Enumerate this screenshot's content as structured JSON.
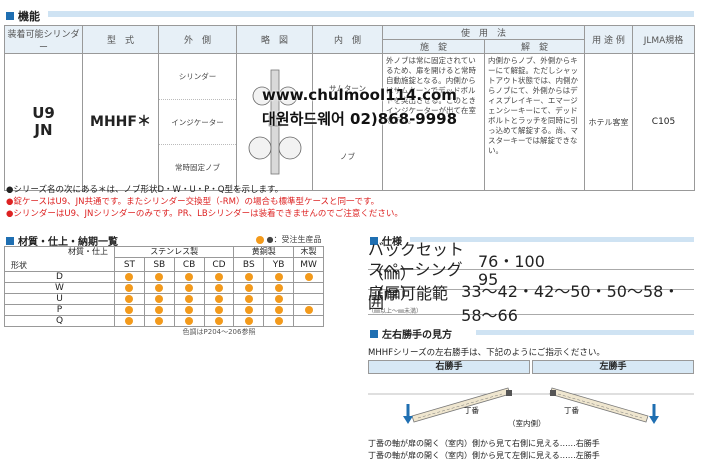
{
  "section_function": {
    "title": "機能"
  },
  "fn_table": {
    "headers": [
      "装着可能シリンダー",
      "型　式",
      "外　側",
      "略　図",
      "内　側",
      "使　用　法",
      "用 途 例",
      "JLMA規格"
    ],
    "usage_sub": [
      "施　錠",
      "解　錠"
    ],
    "cylinder": "U9\nJN",
    "model": "MHHF＊",
    "outside": [
      "シリンダー",
      "インジケーター",
      "常時固定ノブ"
    ],
    "inside": [
      "サムターン",
      "ノブ"
    ],
    "usage_lock": "外ノブは常に固定されているため、扉を開けると常時自動施錠となる。内側からはサムターンでデッドボルトを突出させる。このときインジケーターが出て在室を示す。",
    "usage_unlock": "内側からノブ、外側からキーにて解錠。ただしシャットアウト状態では、内側からノブにて、外側からはディスプレイキー、エマージェンシーキーにて、デッドボルトとラッチを同時に引っ込めて解錠する。尚、マスターキーでは解錠できない。",
    "example": "ホテル客室",
    "jlma": "C105"
  },
  "watermark": {
    "line1": "www.chulmool114.com",
    "line2": "대원하드웨어 02)868-9998"
  },
  "notes": [
    "●シリーズ名の次にある＊は、ノブ形状D・W・U・P・Q型を示します。",
    "●錠ケースはU9、JN共通です。またシリンダー交換型（-RM）の場合も標準型ケースと同一です。",
    "●シリンダーはU9、JNシリンダーのみです。PR、LBシリンダーは装着できませんのでご注意ください。"
  ],
  "materials": {
    "title": "材質・仕上・納期一覧",
    "legend": "●：受注生産品",
    "corner_top": "材質・仕上",
    "corner_bottom": "形状",
    "groups": [
      "ステンレス製",
      "黄銅製",
      "木製"
    ],
    "codes": [
      "ST",
      "SB",
      "CB",
      "CD",
      "BS",
      "YB",
      "MW"
    ],
    "rows": [
      {
        "label": "D",
        "cells": [
          1,
          1,
          1,
          1,
          1,
          1,
          1
        ]
      },
      {
        "label": "W",
        "cells": [
          1,
          1,
          1,
          1,
          1,
          1,
          0
        ]
      },
      {
        "label": "U",
        "cells": [
          1,
          1,
          1,
          1,
          1,
          1,
          0
        ]
      },
      {
        "label": "P",
        "cells": [
          1,
          1,
          1,
          1,
          1,
          1,
          1
        ]
      },
      {
        "label": "Q",
        "cells": [
          1,
          1,
          1,
          1,
          1,
          1,
          0
        ]
      }
    ],
    "footer": "色調はP204〜206参照"
  },
  "specs": {
    "title": "仕様",
    "rows": [
      {
        "label": "バックセット（㎜）",
        "value": "76・100"
      },
      {
        "label": "スペーシング（㎜）",
        "value": "95"
      },
      {
        "label": "扉厚可能範囲",
        "sublabel": "（㎜以上〜㎜未満）",
        "value": "33〜42・42〜50・50〜58・58〜66"
      }
    ]
  },
  "hand": {
    "title": "左右勝手の見方",
    "intro": "MHHFシリーズの左右勝手は、下記のようにご指示ください。",
    "right": "右勝手",
    "left": "左勝手",
    "hinge": "丁番",
    "indoor": "（室内側）",
    "note1": "丁番の軸が扉の開く（室内）側から見て右側に見える……右勝手",
    "note2": "丁番の軸が扉の開く（室内）側から見て左側に見える……左勝手"
  }
}
